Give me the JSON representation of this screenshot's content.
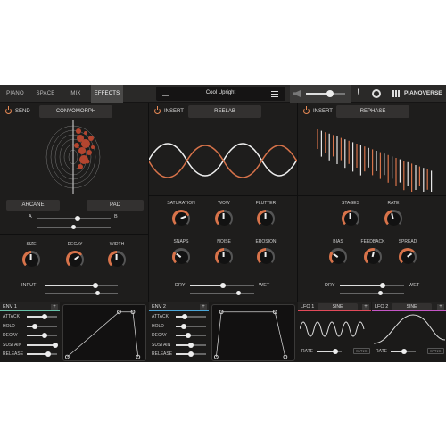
{
  "tabs": [
    {
      "label": "PIANO",
      "active": false
    },
    {
      "label": "SPACE",
      "active": false
    },
    {
      "label": "MIX",
      "active": false
    },
    {
      "label": "EFFECTS",
      "active": true
    }
  ],
  "preset": {
    "name": "Cool Upright"
  },
  "volume": {
    "level": 0.6
  },
  "brand": {
    "name": "PIANOVERSE"
  },
  "panels": {
    "send": {
      "label": "SEND",
      "effect": "CONVOMORPH",
      "sel_a": "ARCANE",
      "sel_b": "PAD",
      "a_label": "A",
      "b_label": "B",
      "morph": 0.55,
      "knobs": [
        {
          "label": "SIZE",
          "value": 0.5
        },
        {
          "label": "DECAY",
          "value": 0.7
        },
        {
          "label": "WIDTH",
          "value": 0.5
        }
      ],
      "input_label": "INPUT",
      "input": 0.7
    },
    "insert1": {
      "label": "INSERT",
      "effect": "REELAB",
      "knobs": [
        {
          "label": "SATURATION",
          "value": 0.75
        },
        {
          "label": "WOW",
          "value": 0.5
        },
        {
          "label": "FLUTTER",
          "value": 0.5
        },
        {
          "label": "SNAPS",
          "value": 0.3
        },
        {
          "label": "NOISE",
          "value": 0.5
        },
        {
          "label": "EROSION",
          "value": 0.5
        }
      ],
      "dry_label": "DRY",
      "wet_label": "WET",
      "mix": 0.52
    },
    "insert2": {
      "label": "INSERT",
      "effect": "REPHASE",
      "knobs": [
        {
          "label": "STAGES",
          "value": 0.5
        },
        {
          "label": "RATE",
          "value": 0.45
        },
        {
          "label": "BIAS",
          "value": 0.3
        },
        {
          "label": "FEEDBACK",
          "value": 0.55
        },
        {
          "label": "SPREAD",
          "value": 0.7
        }
      ],
      "dry_label": "DRY",
      "wet_label": "WET",
      "mix": 0.67
    }
  },
  "env1": {
    "title": "ENV 1",
    "params": [
      {
        "label": "ATTACK",
        "value": 0.6
      },
      {
        "label": "HOLD",
        "value": 0.25
      },
      {
        "label": "DECAY",
        "value": 0.6
      },
      {
        "label": "SUSTAIN",
        "value": 0.95
      },
      {
        "label": "RELEASE",
        "value": 0.7
      }
    ],
    "color": "#66c1a8"
  },
  "env2": {
    "title": "ENV 2",
    "params": [
      {
        "label": "ATTACK",
        "value": 0.3
      },
      {
        "label": "HOLD",
        "value": 0.25
      },
      {
        "label": "DECAY",
        "value": 0.4
      },
      {
        "label": "SUSTAIN",
        "value": 0.5
      },
      {
        "label": "RELEASE",
        "value": 0.5
      }
    ],
    "color": "#4aa6d8"
  },
  "lfo1": {
    "title": "LFO 1",
    "shape": "SINE",
    "rate_label": "RATE",
    "sync_label": "SYNC",
    "rate": 0.75,
    "color": "#e24a5a"
  },
  "lfo2": {
    "title": "LFO 2",
    "shape": "SINE",
    "rate_label": "RATE",
    "sync_label": "SYNC",
    "rate": 0.55,
    "color": "#c456c6"
  },
  "plus_label": "+",
  "colors": {
    "accent": "#d8734a",
    "panel": "#1e1d1c"
  }
}
